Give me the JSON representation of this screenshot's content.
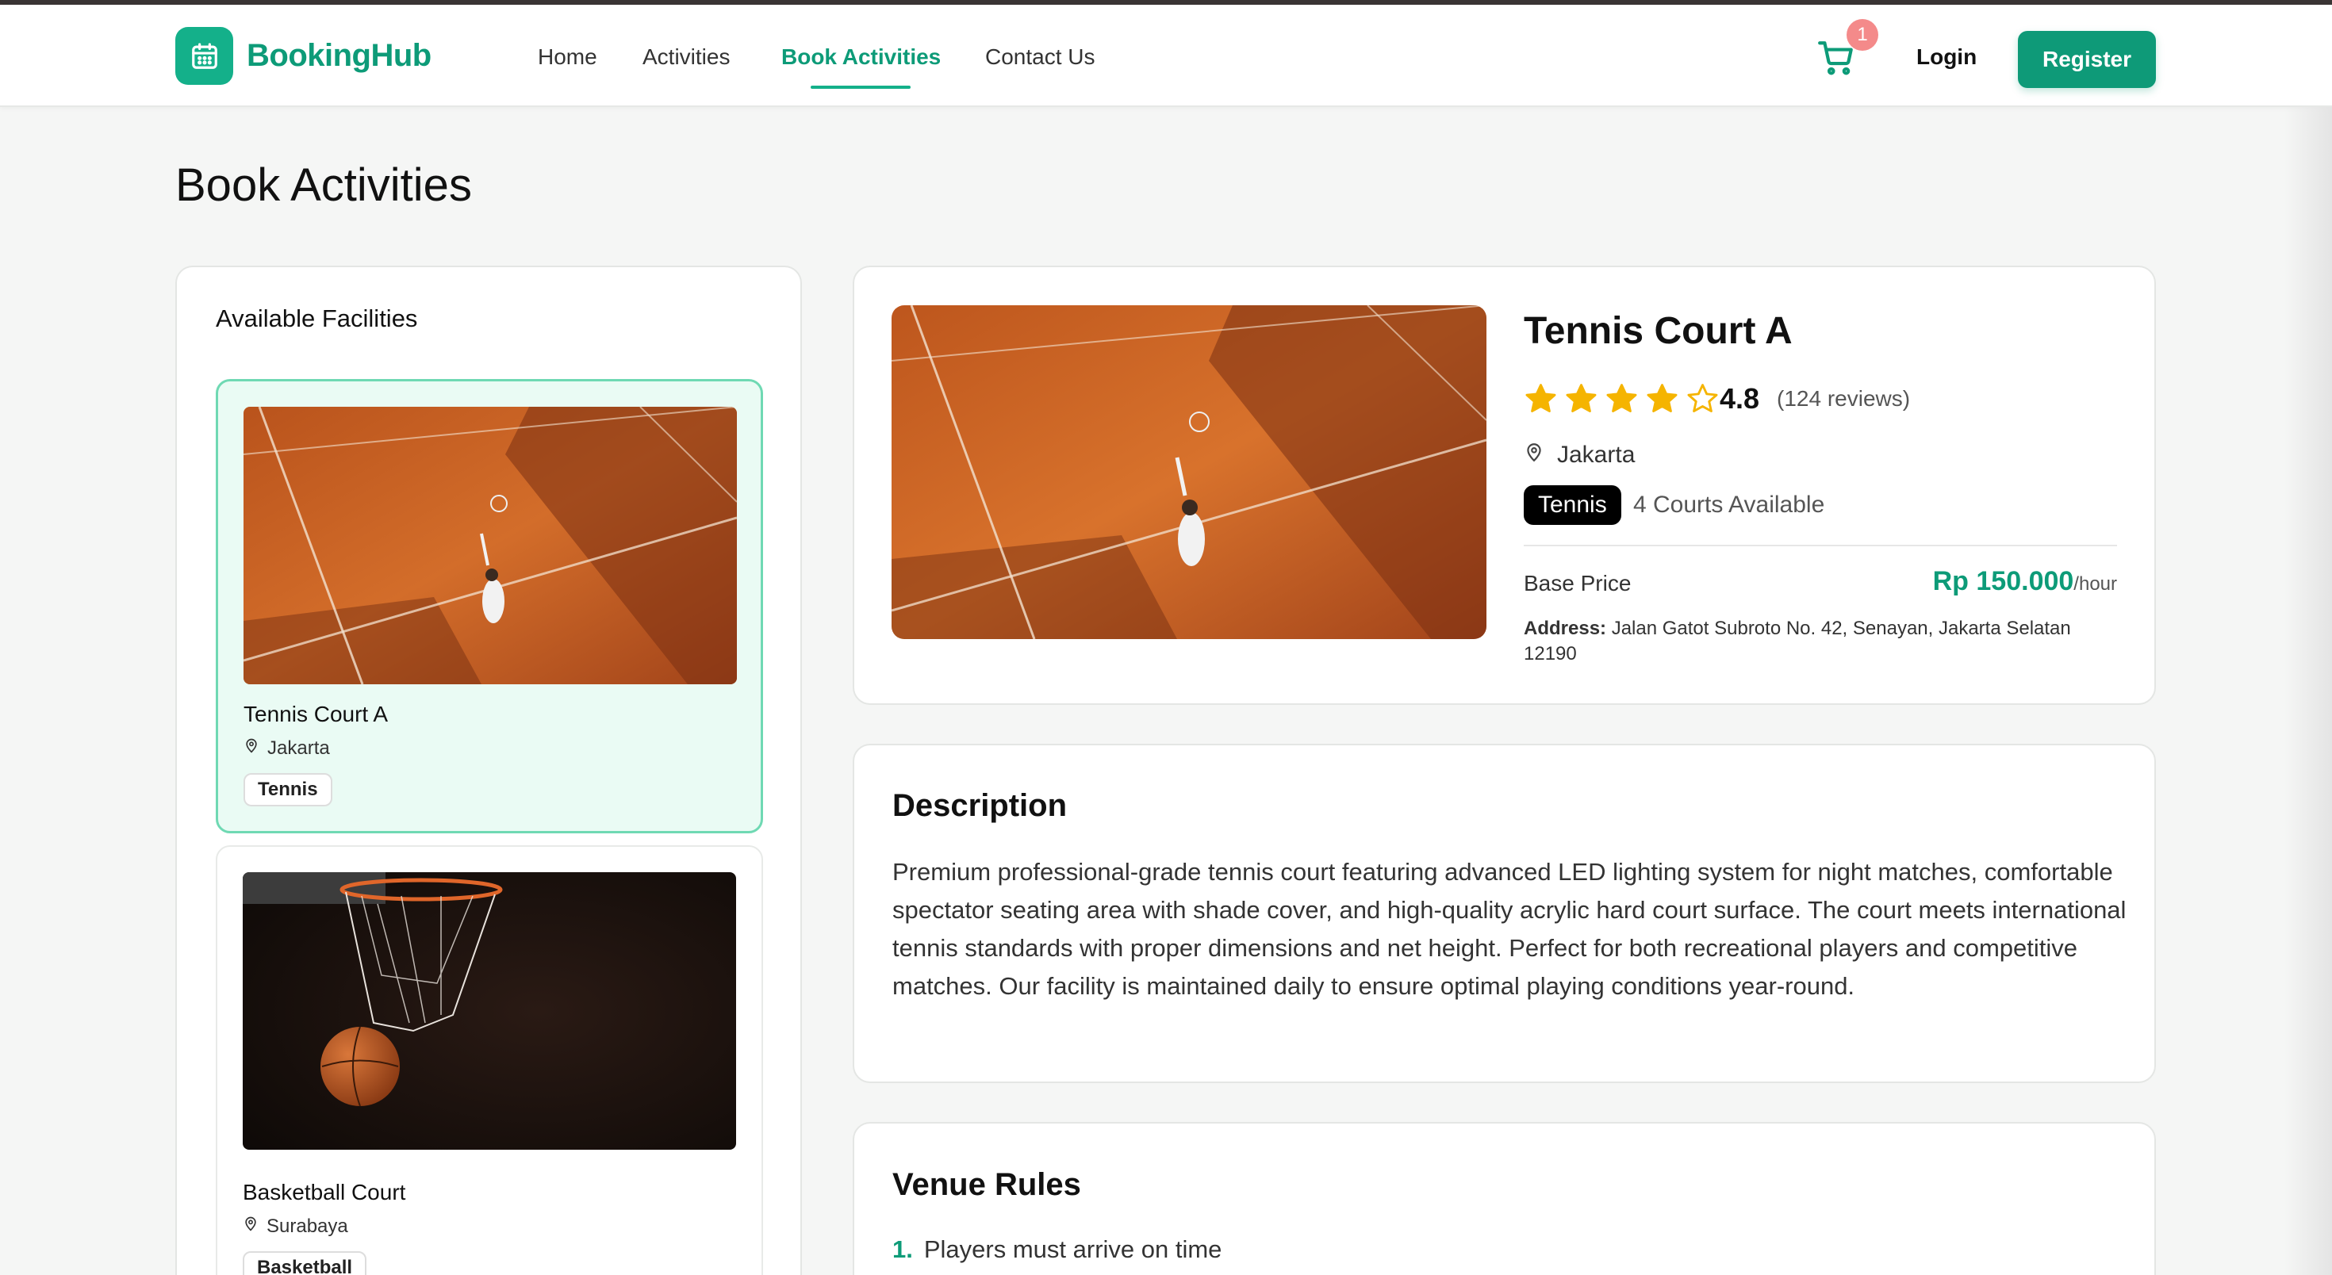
{
  "app": {
    "name": "BookingHub"
  },
  "nav": {
    "items": [
      {
        "label": "Home"
      },
      {
        "label": "Activities"
      },
      {
        "label": "Book Activities",
        "active": true
      },
      {
        "label": "Contact Us"
      }
    ],
    "cart_count": "1",
    "login_label": "Login",
    "register_label": "Register"
  },
  "page": {
    "title": "Book Activities"
  },
  "facilities": {
    "heading": "Available Facilities",
    "items": [
      {
        "name": "Tennis Court A",
        "location": "Jakarta",
        "tag": "Tennis",
        "selected": true
      },
      {
        "name": "Basketball Court",
        "location": "Surabaya",
        "tag": "Basketball",
        "selected": false
      }
    ]
  },
  "detail": {
    "title": "Tennis Court A",
    "rating": "4.8",
    "rating_value": 4.8,
    "stars_filled": 4,
    "stars_total": 5,
    "reviews": "(124 reviews)",
    "location": "Jakarta",
    "sport": "Tennis",
    "courts": "4 Courts Available",
    "base_price_label": "Base Price",
    "price": "Rp 150.000",
    "price_unit": "/hour",
    "address_label": "Address:",
    "address": "Jalan Gatot Subroto No. 42, Senayan, Jakarta Selatan 12190"
  },
  "description": {
    "heading": "Description",
    "text": "Premium professional-grade tennis court featuring advanced LED lighting system for night matches, comfortable spectator seating area with shade cover, and high-quality acrylic hard court surface. The court meets international tennis standards with proper dimensions and net height. Perfect for both recreational players and competitive matches. Our facility is maintained daily to ensure optimal playing conditions year-round."
  },
  "rules": {
    "heading": "Venue Rules",
    "items": [
      {
        "num": "1.",
        "text": "Players must arrive on time"
      }
    ]
  },
  "colors": {
    "brand": "#0d9b78",
    "star": "#f5b400",
    "accent_light": "#eafbf4"
  },
  "icons": [
    "calendar-icon",
    "cart-icon",
    "location-pin-icon",
    "star-icon"
  ]
}
